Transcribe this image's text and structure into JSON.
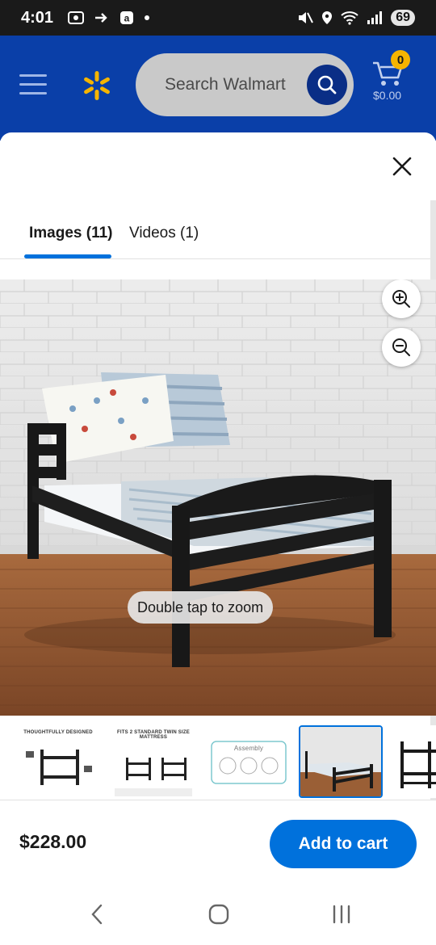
{
  "status": {
    "time": "4:01",
    "battery": "69"
  },
  "header": {
    "search_placeholder": "Search Walmart",
    "cart_count": "0",
    "cart_total": "$0.00",
    "colors": {
      "header_bg": "#0a3fa8",
      "spark": "#f5b400",
      "accent": "#0071dc"
    }
  },
  "modal": {
    "tabs": [
      {
        "label": "Images (11)",
        "active": true
      },
      {
        "label": "Videos (1)",
        "active": false
      }
    ],
    "zoom_hint": "Double tap to zoom",
    "thumbnails": [
      {
        "title": "THOUGHTFULLY DESIGNED"
      },
      {
        "title": "FITS 2 STANDARD TWIN SIZE MATTRESS"
      },
      {
        "title": "Assembly"
      },
      {
        "title": "",
        "selected": true
      },
      {
        "title": ""
      }
    ]
  },
  "footer": {
    "price": "$228.00",
    "add_to_cart": "Add to cart"
  }
}
